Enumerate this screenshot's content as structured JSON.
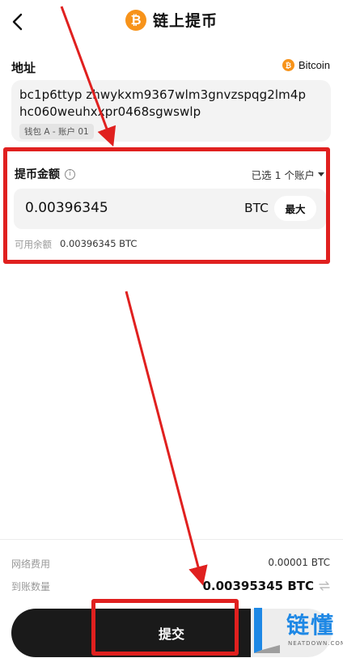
{
  "header": {
    "title": "链上提币",
    "coin_badge": "₿"
  },
  "address": {
    "label": "地址",
    "coin_badge": "₿",
    "coin_name": "Bitcoin",
    "value": "bc1p6ttyp zhwykxm9367wlm3gnvzspqg2lm4phc060weuhxxpr0468sgwswlp",
    "wallet_tag": "钱包 A - 账户 01"
  },
  "amount": {
    "label": "提币金额",
    "info_glyph": "i",
    "account_selector": "已选 1 个账户",
    "value": "0.00396345",
    "unit": "BTC",
    "max_label": "最大",
    "available_label": "可用余额",
    "available_value": "0.00396345 BTC"
  },
  "summary": {
    "fee_label": "网络费用",
    "fee_value": "0.00001 BTC",
    "receive_label": "到账数量",
    "receive_value": "0.00395345 BTC"
  },
  "submit": {
    "label": "提交"
  },
  "watermark": {
    "text": "链懂",
    "sub": "NEATDOWN.COM"
  },
  "colors": {
    "accent_btc": "#f7931a",
    "highlight_red": "#e0201f",
    "button_dark": "#1a1a1a",
    "field_bg": "#f3f3f3",
    "watermark_blue": "#1e88e5"
  }
}
